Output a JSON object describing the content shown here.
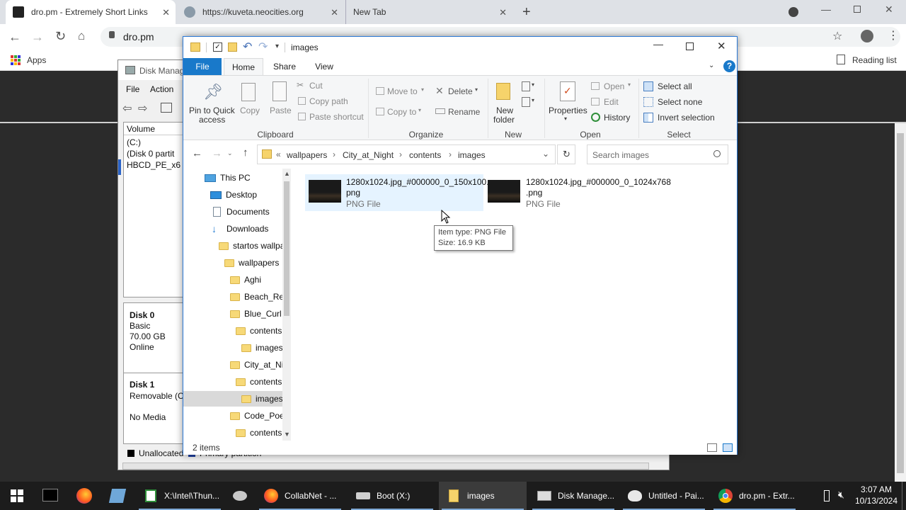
{
  "browser": {
    "tabs": [
      {
        "title": "dro.pm - Extremely Short Links",
        "active": true
      },
      {
        "title": "https://kuveta.neocities.org",
        "active": false
      },
      {
        "title": "New Tab",
        "active": false
      }
    ],
    "new_tab_icon": "plus-icon",
    "window_controls": [
      "minimize-icon",
      "restore-icon",
      "close-icon"
    ],
    "address": "dro.pm",
    "bookmarks": {
      "apps_label": "Apps",
      "reading_list_label": "Reading list"
    }
  },
  "disk_management": {
    "title": "Disk Manag",
    "menu": [
      "File",
      "Action"
    ],
    "volume_header": "Volume",
    "volumes": [
      "(C:)",
      "(Disk 0 partit",
      "HBCD_PE_x6"
    ],
    "disks": [
      {
        "name": "Disk 0",
        "type": "Basic",
        "size": "70.00 GB",
        "status": "Online"
      },
      {
        "name": "Disk 1",
        "type": "Removable (C",
        "size": "",
        "status": "No Media"
      }
    ],
    "legend": [
      "Unallocated",
      "Primary partition"
    ]
  },
  "explorer": {
    "title": "images",
    "tabs": [
      "File",
      "Home",
      "Share",
      "View"
    ],
    "ribbon": {
      "clipboard": {
        "pin": "Pin to Quick access",
        "copy": "Copy",
        "paste": "Paste",
        "cut": "Cut",
        "copy_path": "Copy path",
        "paste_shortcut": "Paste shortcut",
        "group": "Clipboard"
      },
      "organize": {
        "move_to": "Move to",
        "copy_to": "Copy to",
        "delete": "Delete",
        "rename": "Rename",
        "group": "Organize"
      },
      "new": {
        "new_folder_line1": "New",
        "new_folder_line2": "folder",
        "group": "New"
      },
      "open": {
        "properties": "Properties",
        "open": "Open",
        "edit": "Edit",
        "history": "History",
        "group": "Open"
      },
      "select": {
        "select_all": "Select all",
        "select_none": "Select none",
        "invert": "Invert selection",
        "group": "Select"
      }
    },
    "breadcrumb": [
      "wallpapers",
      "City_at_Night",
      "contents",
      "images"
    ],
    "breadcrumb_overflow": "«",
    "search_placeholder": "Search images",
    "nav_tree": [
      {
        "label": "This PC",
        "icon": "computer-icon"
      },
      {
        "label": "Desktop",
        "icon": "desktop-icon"
      },
      {
        "label": "Documents",
        "icon": "documents-icon"
      },
      {
        "label": "Downloads",
        "icon": "downloads-icon"
      },
      {
        "label": "startos wallpa",
        "icon": "folder-icon"
      },
      {
        "label": "wallpapers",
        "icon": "folder-icon"
      },
      {
        "label": "Aghi",
        "icon": "folder-icon"
      },
      {
        "label": "Beach_Ref",
        "icon": "folder-icon"
      },
      {
        "label": "Blue_Curl",
        "icon": "folder-icon"
      },
      {
        "label": "contents",
        "icon": "folder-icon"
      },
      {
        "label": "images",
        "icon": "folder-icon"
      },
      {
        "label": "City_at_Ni",
        "icon": "folder-icon"
      },
      {
        "label": "contents",
        "icon": "folder-icon"
      },
      {
        "label": "images",
        "icon": "folder-icon",
        "selected": true
      },
      {
        "label": "Code_Poe",
        "icon": "folder-icon"
      },
      {
        "label": "contents",
        "icon": "folder-icon"
      }
    ],
    "files": [
      {
        "name_line1": "1280x1024.jpg_#000000_0_150x100.",
        "name_line2": "png",
        "type": "PNG File"
      },
      {
        "name_line1": "1280x1024.jpg_#000000_0_1024x768",
        "name_line2": ".png",
        "type": "PNG File"
      }
    ],
    "tooltip": {
      "line1": "Item type: PNG File",
      "line2": "Size: 16.9 KB"
    },
    "status": "2 items"
  },
  "taskbar": {
    "items": [
      {
        "label": "X:\\Intel\\Thun...",
        "icon": "notepad-icon"
      },
      {
        "label": "CollabNet - ...",
        "icon": "firefox-icon"
      },
      {
        "label": "Boot (X:)",
        "icon": "drive-icon"
      },
      {
        "label": "images",
        "icon": "folder-icon",
        "active": true
      },
      {
        "label": "Disk Manage...",
        "icon": "disk-management-icon"
      },
      {
        "label": "Untitled - Pai...",
        "icon": "paint-icon"
      },
      {
        "label": "dro.pm - Extr...",
        "icon": "chrome-icon"
      }
    ],
    "time": "3:07 AM",
    "date": "10/13/2024"
  }
}
